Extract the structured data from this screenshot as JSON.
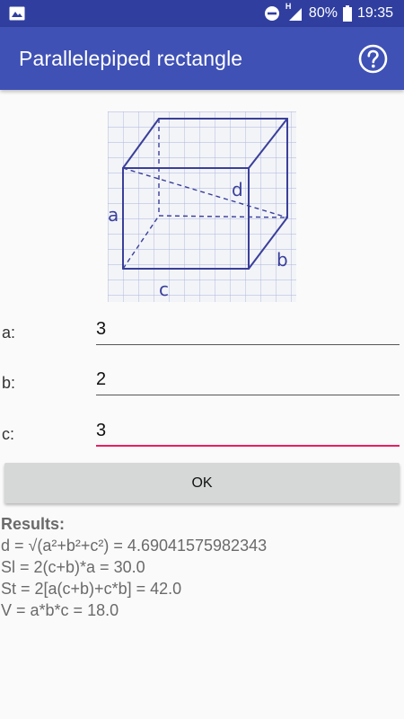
{
  "status_bar": {
    "battery": "80%",
    "time": "19:35",
    "network": "H"
  },
  "app_bar": {
    "title": "Parallelepiped rectangle"
  },
  "figure": {
    "label_a": "a",
    "label_b": "b",
    "label_c": "c",
    "label_d": "d"
  },
  "fields": {
    "a": {
      "label": "a:",
      "value": "3"
    },
    "b": {
      "label": "b:",
      "value": "2"
    },
    "c": {
      "label": "c:",
      "value": "3"
    }
  },
  "ok_button": {
    "label": "OK"
  },
  "results": {
    "heading": "Results:",
    "lines": [
      "d = √(a²+b²+c²) = 4.69041575982343",
      "Sl = 2(c+b)*a = 30.0",
      "St = 2[a(c+b)+c*b] = 42.0",
      "V = a*b*c = 18.0"
    ]
  },
  "colors": {
    "status_bar": "#303f9f",
    "app_bar": "#3f51b5",
    "focus_underline": "#e91e63",
    "drawing_ink": "#3a3f9a"
  }
}
